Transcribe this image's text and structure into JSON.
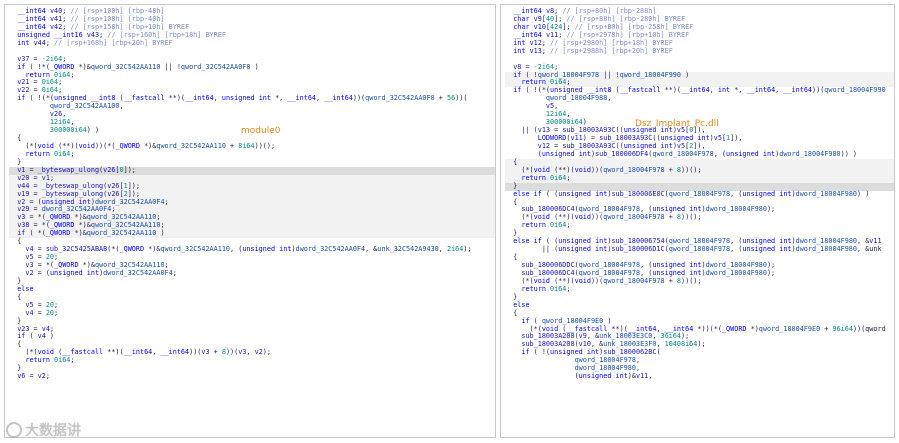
{
  "colors": {
    "keyword": "#0000ff",
    "variable": "#1515b8",
    "global": "#1a4fa8",
    "comment": "#7e8dc4",
    "number": "#008a80",
    "label": "#e08a1a",
    "highlight": "#dcdcdc"
  },
  "left_pane": {
    "overlay_label": "module0",
    "lines": [
      "  __int64 v40; // [rsp+100h] [rbp-48h]",
      "  __int64 v41; // [rsp+108h] [rbp-40h]",
      "  __int64 v42; // [rsp+158h] [rbp+10h] BYREF",
      "  unsigned __int16 v43; // [rsp+160h] [rbp+18h] BYREF",
      "  int v44; // [rsp+168h] [rbp+20h] BYREF",
      "",
      "  v37 = -2i64;",
      "  if ( !*(_QWORD *)&qword_32C542AA110 || !qword_32C542AA0F8 )",
      "    return 0i64;",
      "  v21 = 0i64;",
      "  v22 = 0i64;",
      "  if ( !(*(unsigned __int8 (__fastcall **)(__int64, unsigned int *, __int64, __int64))(qword_32C542AA0F8 + 56))(",
      "          qword_32C542AA100,",
      "          v26,",
      "          12i64,",
      "          300000i64) )",
      "  {",
      "    (*(void (**)(void))(*(_QWORD *)&qword_32C542AA110 + 8i64))();",
      "    return 0i64;",
      "  }",
      "  v1 = _byteswap_ulong(v26[0]);",
      "  v20 = v1;",
      "  v44 = _byteswap_ulong(v26[1]);",
      "  v19 = _byteswap_ulong(v26[2]);",
      "  v2 = (unsigned int)dword_32C542AA0F4;",
      "  v29 = dword_32C542AA0F4;",
      "  v3 = *(_QWORD *)&qword_32C542AA110;",
      "  v38 = *(_QWORD *)&qword_32C542AA110;",
      "  if ( *(_QWORD *)&qword_32C542AA110 )",
      "  {",
      "    v4 = sub_32C5425ABAB(*(_QWORD *)&qword_32C542AA110, (unsigned int)dword_32C542AA0F4, &unk_32C542A9430, 2i64);",
      "    v5 = 20;",
      "    v3 = *(_QWORD *)&qword_32C542AA110;",
      "    v2 = (unsigned int)dword_32C542AA0F4;",
      "  }",
      "  else",
      "  {",
      "    v5 = 20;",
      "    v4 = 20;",
      "  }",
      "  v23 = v4;",
      "  if ( v4 )",
      "  {",
      "    (*(void (__fastcall **)(__int64, __int64))(v3 + 8))(v3, v2);",
      "    return 0i64;",
      "  }",
      "  v6 = v2;"
    ]
  },
  "right_pane": {
    "overlay_label": "Dsz_Implant_Pc.dll",
    "lines": [
      "  __int64 v8; // [rsp+80h] [rbp-288h]",
      "  char v9[40]; // [rsp+88h] [rbp-280h] BYREF",
      "  char v10[424]; // [rsp+B0h] [rbp-258h] BYREF",
      "  __int64 v11; // [rsp+2978h] [rbp+10h] BYREF",
      "  int v12; // [rsp+2980h] [rbp+18h] BYREF",
      "  int v13; // [rsp+2988h] [rbp+20h] BYREF",
      "",
      "  v8 = -2i64;",
      "  if ( !qword_18004F978 || !qword_18004F990 )",
      "    return 0i64;",
      "  if ( !(*(unsigned __int8 (__fastcall **)(__int64, int *, __int64, __int64))(qword_18004F990",
      "          qword_18004F988,",
      "          v5,",
      "          12i64,",
      "          300000i64)",
      "    || (v13 = sub_18003A93C((unsigned int)v5[0]),",
      "        LODWORD(v11) = sub_18003A93C((unsigned int)v5[1]),",
      "        v12 = sub_18003A93C((unsigned int)v5[2]),",
      "        (unsigned int)sub_180006DF4(qword_18004F978, (unsigned int)dword_18004F980)) )",
      "  {",
      "    (*(void (**)(void))(qword_18004F978 + 8))();",
      "    return 0i64;",
      "  }",
      "  else if ( (unsigned int)sub_180006E0C(qword_18004F978, (unsigned int)dword_18004F980) )",
      "  {",
      "    sub_180006DC4(qword_18004F978, (unsigned int)dword_18004F980);",
      "    (*(void (**)(void))(qword_18004F978 + 8))();",
      "    return 0i64;",
      "  }",
      "  else if ( (unsigned int)sub_180006754(qword_18004F978, (unsigned int)dword_18004F980, &v11",
      "         || (unsigned int)sub_180006D1C(qword_18004F978, (unsigned int)dword_18004F980, &unk",
      "  {",
      "    sub_180006DDC(qword_18004F978, (unsigned int)dword_18004F980);",
      "    sub_180006DC4(qword_18004F978, (unsigned int)dword_18004F980);",
      "    (*(void (**)(void))(qword_18004F978 + 8))();",
      "    return 0i64;",
      "  }",
      "  else",
      "  {",
      "    if ( qword_18004F9E0 )",
      "      (*(void (__fastcall **)(__int64, __int64 *))(*(_QWORD *)qword_18004F9E0 + 96i64))(qword",
      "    sub_18003A208(v9, &unk_18003E3C0, 36i64);",
      "    sub_18003A208(v10, &unk_18003E3F0, 10408i64);",
      "    if ( !(unsigned int)sub_1800062BC(",
      "                 qword_18004F978,",
      "                 dword_18004F980,",
      "                 (unsigned int)&v11,"
    ]
  },
  "watermark": {
    "text": "大数据讲"
  }
}
